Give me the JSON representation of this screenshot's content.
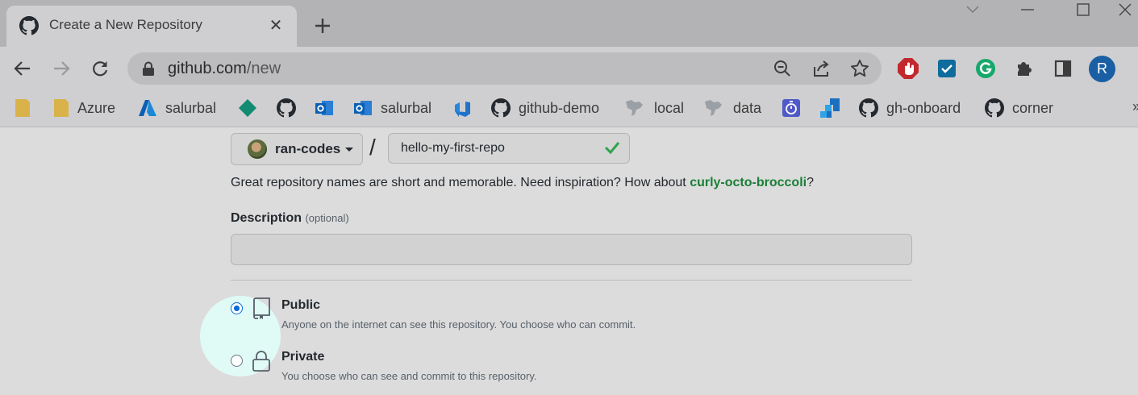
{
  "browser": {
    "tab": {
      "title": "Create a New Repository",
      "close_glyph": "✕"
    },
    "new_tab_glyph": "+",
    "url": {
      "host": "github.com",
      "path": "/new"
    },
    "profile_initial": "R",
    "bookmarks": [
      {
        "label": "",
        "icon": "folder-icon"
      },
      {
        "label": "Azure",
        "icon": "folder-icon"
      },
      {
        "label": "salurbal",
        "icon": "azure-icon"
      },
      {
        "label": "",
        "icon": "diamond-icon"
      },
      {
        "label": "",
        "icon": "github-icon"
      },
      {
        "label": "",
        "icon": "outlook-icon"
      },
      {
        "label": "salurbal",
        "icon": "outlook-icon"
      },
      {
        "label": "",
        "icon": "azure-devops-icon"
      },
      {
        "label": "github-demo",
        "icon": "github-icon"
      },
      {
        "label": "local",
        "icon": "map-icon"
      },
      {
        "label": "data",
        "icon": "map-icon"
      },
      {
        "label": "",
        "icon": "timer-icon"
      },
      {
        "label": "",
        "icon": "blocks-icon"
      },
      {
        "label": "gh-onboard",
        "icon": "github-icon"
      },
      {
        "label": "corner",
        "icon": "github-icon"
      }
    ],
    "more_glyph": "»"
  },
  "form": {
    "owner": "ran-codes",
    "separator": "/",
    "repo_name": "hello-my-first-repo",
    "hint_prefix": "Great repository names are short and memorable. Need inspiration? How about ",
    "hint_suggestion": "curly-octo-broccoli",
    "hint_suffix": "?",
    "description_label": "Description",
    "description_optional": "(optional)",
    "description_value": "",
    "visibility": [
      {
        "title": "Public",
        "desc": "Anyone on the internet can see this repository. You choose who can commit.",
        "checked": true
      },
      {
        "title": "Private",
        "desc": "You choose who can see and commit to this repository.",
        "checked": false
      }
    ]
  },
  "colors": {
    "accent": "#0969da",
    "success": "#1a7f37",
    "highlight": "#e0fbf6"
  }
}
